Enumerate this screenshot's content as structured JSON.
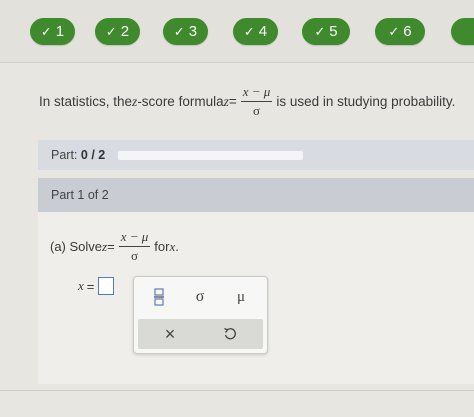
{
  "nav": {
    "pills": [
      {
        "label": "1",
        "state": "correct"
      },
      {
        "label": "2",
        "state": "correct"
      },
      {
        "label": "3",
        "state": "correct"
      },
      {
        "label": "4",
        "state": "correct"
      },
      {
        "label": "5",
        "state": "correct"
      },
      {
        "label": "6",
        "state": "correct"
      }
    ],
    "check_glyph": "✓",
    "accent_color": "#3f8a2c"
  },
  "question": {
    "prefix": "In statistics, the ",
    "var": "z",
    "middle": "-score formula ",
    "lhs": "z",
    "eq": "=",
    "frac_num": "x − μ",
    "frac_den": "σ",
    "suffix": " is used in studying probability."
  },
  "part_progress": {
    "label": "Part:",
    "value": "0 / 2",
    "completed_fraction": 0
  },
  "part": {
    "title": "Part 1 of 2",
    "subq_prefix": "(a) Solve ",
    "subq_lhs": "z",
    "subq_eq": "=",
    "subq_num": "x − μ",
    "subq_den": "σ",
    "subq_for": " for ",
    "subq_var": "x",
    "subq_end": ".",
    "answer_var": "x",
    "answer_eq": "="
  },
  "palette": {
    "fraction_icon": "fraction-icon",
    "sigma": "σ",
    "mu": "μ",
    "clear": "×",
    "undo_icon": "undo-icon"
  }
}
